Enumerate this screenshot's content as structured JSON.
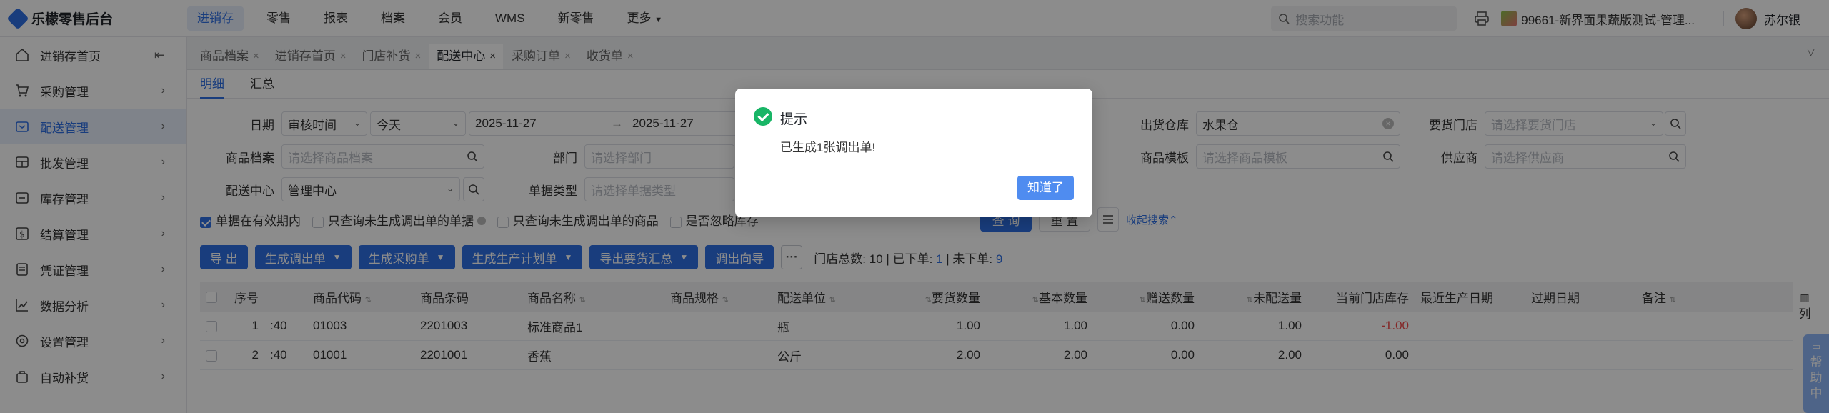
{
  "app": {
    "title": "乐檬零售后台"
  },
  "topnav": {
    "items": [
      "进销存",
      "零售",
      "报表",
      "档案",
      "会员",
      "WMS",
      "新零售"
    ],
    "more": "更多",
    "active_index": 0
  },
  "topright": {
    "search_placeholder": "搜索功能",
    "store": "99661-新界面果蔬版测试-管理...",
    "user": "苏尔银"
  },
  "sidebar": {
    "items": [
      {
        "label": "进销存首页",
        "icon": "home-icon"
      },
      {
        "label": "采购管理",
        "icon": "cart-icon"
      },
      {
        "label": "配送管理",
        "icon": "truck-icon"
      },
      {
        "label": "批发管理",
        "icon": "wholesale-icon"
      },
      {
        "label": "库存管理",
        "icon": "inventory-icon"
      },
      {
        "label": "结算管理",
        "icon": "settlement-icon"
      },
      {
        "label": "凭证管理",
        "icon": "voucher-icon"
      },
      {
        "label": "数据分析",
        "icon": "chart-icon"
      },
      {
        "label": "设置管理",
        "icon": "settings-icon"
      },
      {
        "label": "自动补货",
        "icon": "auto-replenish-icon"
      }
    ],
    "active_index": 2
  },
  "tabs": [
    {
      "label": "商品档案"
    },
    {
      "label": "进销存首页"
    },
    {
      "label": "门店补货"
    },
    {
      "label": "配送中心"
    },
    {
      "label": "采购订单"
    },
    {
      "label": "收货单"
    }
  ],
  "active_tab": 3,
  "subtabs": [
    "明细",
    "汇总"
  ],
  "filters": {
    "date_label": "日期",
    "date_type": "审核时间",
    "date_range": "今天",
    "date_start": "2025-11-27",
    "date_end": "2025-11-27",
    "date_sep": "→",
    "warehouse_label": "出货仓库",
    "warehouse_value": "水果仓",
    "req_store_label": "要货门店",
    "req_store_ph": "请选择要货门店",
    "product_label": "商品档案",
    "product_ph": "请选择商品档案",
    "dept_label": "部门",
    "dept_ph": "请选择部门",
    "template_label": "商品模板",
    "template_ph": "请选择商品模板",
    "supplier_label": "供应商",
    "supplier_ph": "请选择供应商",
    "center_label": "配送中心",
    "center_value": "管理中心",
    "doctype_label": "单据类型",
    "doctype_ph": "请选择单据类型"
  },
  "checks": {
    "valid_period": "单据在有效期内",
    "no_transfer_docs": "只查询未生成调出单的单据",
    "no_transfer_items": "只查询未生成调出单的商品",
    "ignore_stock": "是否忽略库存"
  },
  "actions": {
    "query": "查 询",
    "reset": "重 置",
    "collapse": "收起搜索"
  },
  "buttons": {
    "export": "导 出",
    "gen_transfer": "生成调出单",
    "gen_purchase": "生成采购单",
    "gen_production": "生成生产计划单",
    "export_summary": "导出要货汇总",
    "transfer_wizard": "调出向导",
    "more": "···"
  },
  "stats": {
    "total_label": "门店总数:",
    "total": "10",
    "ordered_label": "已下单:",
    "ordered": "1",
    "not_ordered_label": "未下单:",
    "not_ordered": "9"
  },
  "table": {
    "headers": [
      "序号",
      "",
      "商品代码",
      "商品条码",
      "商品名称",
      "商品规格",
      "配送单位",
      "要货数量",
      "基本数量",
      "赠送数量",
      "未配送量",
      "当前门店库存",
      "最近生产日期",
      "过期日期",
      "备注"
    ],
    "rows": [
      [
        "1",
        ":40",
        "01003",
        "2201003",
        "标准商品1",
        "",
        "瓶",
        "1.00",
        "1.00",
        "0.00",
        "1.00",
        "-1.00",
        "",
        "",
        ""
      ],
      [
        "2",
        ":40",
        "01001",
        "2201001",
        "香蕉",
        "",
        "公斤",
        "2.00",
        "2.00",
        "0.00",
        "2.00",
        "0.00",
        "",
        "",
        ""
      ]
    ],
    "column_toggle": "列"
  },
  "help": "帮助中",
  "dialog": {
    "title": "提示",
    "message": "已生成1张调出单!",
    "ok": "知道了"
  }
}
